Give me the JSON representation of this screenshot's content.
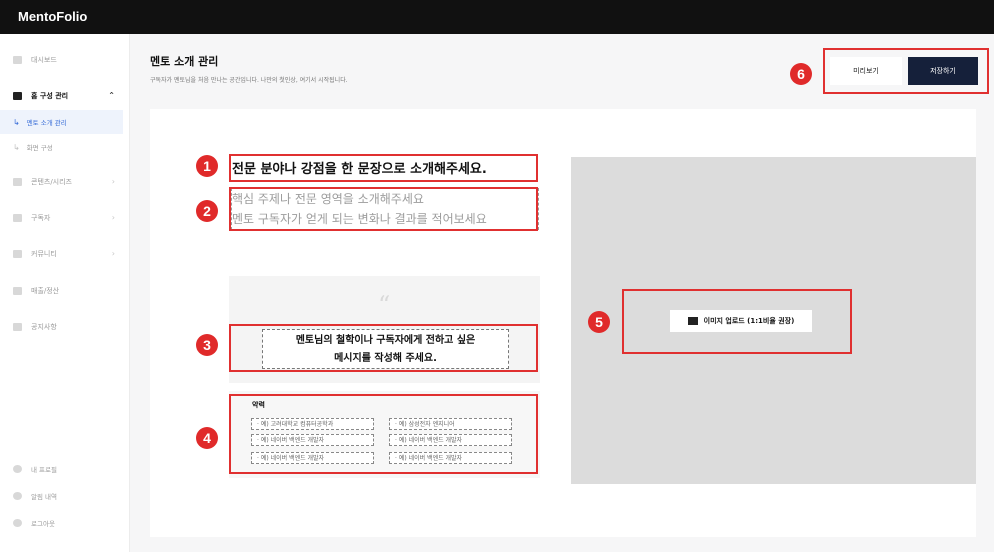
{
  "app": {
    "brand": "MentoFolio"
  },
  "sidebar": {
    "items": [
      {
        "label": "대시보드",
        "icon": "dashboard-icon"
      },
      {
        "label": "홈 구성 관리",
        "icon": "monitor-icon",
        "chevron": "⌃"
      },
      {
        "label": "멘토 소개 관리",
        "arrow": "↳"
      },
      {
        "label": "화면 구성",
        "arrow": "↳"
      },
      {
        "label": "콘텐츠/시리즈",
        "icon": "document-icon",
        "chevron": "›"
      },
      {
        "label": "구독자",
        "icon": "subscriber-icon",
        "chevron": "›"
      },
      {
        "label": "커뮤니티",
        "icon": "community-icon",
        "chevron": "›"
      },
      {
        "label": "매출/정산",
        "icon": "chart-icon"
      },
      {
        "label": "공지사항",
        "icon": "megaphone-icon"
      }
    ],
    "bottom": [
      {
        "label": "내 프로필",
        "icon": "profile-icon"
      },
      {
        "label": "알림 내역",
        "icon": "bell-icon"
      },
      {
        "label": "로그아웃",
        "icon": "logout-icon"
      }
    ]
  },
  "header": {
    "title": "멘토 소개 관리",
    "subtitle": "구독자가 멘토님을 처음 만나는 공간입니다. 나만의 첫인상, 여기서 시작됩니다.",
    "preview_label": "미리보기",
    "save_label": "저장하기"
  },
  "editor": {
    "headline": "전문 분야나 강점을 한 문장으로 소개해주세요.",
    "placeholder_line1": "핵심 주제나 전문 영역을 소개해주세요",
    "placeholder_line2": "멘토 구독자가 얻게 되는 변화나 결과를 적어보세요",
    "quote_mark": "“",
    "quote_line1": "멘토님의 철학이나 구독자에게 전하고 싶은",
    "quote_line2": "메시지를 작성해 주세요.",
    "career_title": "약력",
    "career_left": [
      "· 예) 고려대학교 컴퓨터공학과",
      "· 예) 네이버 백엔드 개발자",
      "· 예) 네이버 백엔드 개발자"
    ],
    "career_right": [
      "· 예) 삼성전자 엔지니어",
      "· 예) 네이버 백엔드 개발자",
      "· 예) 네이버 백엔드 개발자"
    ],
    "upload_label": "이미지 업로드 (1:1비율 권장)"
  },
  "annotations": {
    "badges": [
      "1",
      "2",
      "3",
      "4",
      "5",
      "6"
    ]
  },
  "colors": {
    "accent": "#e03030",
    "brand_dark": "#15203a",
    "active_blue": "#3b6fd8"
  }
}
